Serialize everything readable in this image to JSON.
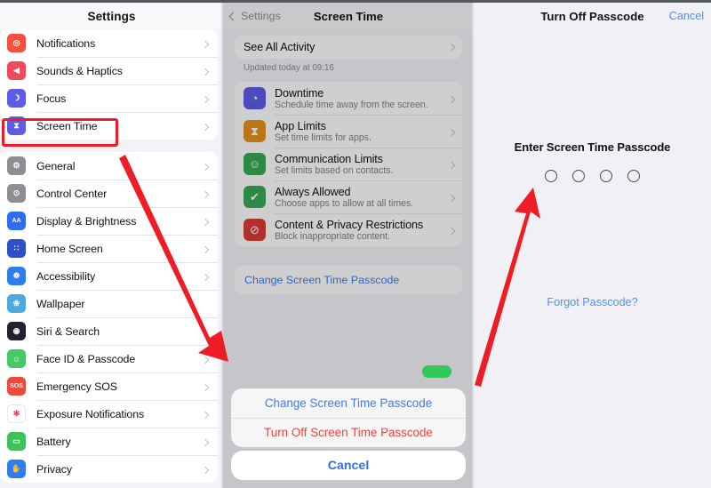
{
  "sidebar": {
    "title": "Settings",
    "groups": [
      {
        "items": [
          {
            "label": "Notifications",
            "icon": "bell-icon",
            "color": "#f4513c",
            "glyph": "◎",
            "chevron": true
          },
          {
            "label": "Sounds & Haptics",
            "icon": "speaker-icon",
            "color": "#ef4a5c",
            "glyph": "◀",
            "chevron": true
          },
          {
            "label": "Focus",
            "icon": "moon-icon",
            "color": "#5c5ce6",
            "glyph": "☽",
            "chevron": true
          },
          {
            "label": "Screen Time",
            "icon": "hourglass-icon",
            "color": "#5c5ce6",
            "glyph": "⧗",
            "chevron": true
          }
        ]
      },
      {
        "items": [
          {
            "label": "General",
            "icon": "gear-icon",
            "color": "#8e8e93",
            "glyph": "⚙",
            "chevron": true
          },
          {
            "label": "Control Center",
            "icon": "sliders-icon",
            "color": "#8e8e93",
            "glyph": "⊙",
            "chevron": true
          },
          {
            "label": "Display & Brightness",
            "icon": "text-size-icon",
            "color": "#2f6cf0",
            "glyph": "AA",
            "chevron": true
          },
          {
            "label": "Home Screen",
            "icon": "home-screen-icon",
            "color": "#2d50c8",
            "glyph": "∷",
            "chevron": true
          },
          {
            "label": "Accessibility",
            "icon": "accessibility-icon",
            "color": "#2f7ef0",
            "glyph": "☸",
            "chevron": true
          },
          {
            "label": "Wallpaper",
            "icon": "wallpaper-icon",
            "color": "#4ea8e0",
            "glyph": "❀",
            "chevron": false
          },
          {
            "label": "Siri & Search",
            "icon": "siri-icon",
            "color": "#241f33",
            "glyph": "◉",
            "chevron": false
          },
          {
            "label": "Face ID & Passcode",
            "icon": "face-id-icon",
            "color": "#48c863",
            "glyph": "☺",
            "chevron": true
          },
          {
            "label": "Emergency SOS",
            "icon": "sos-icon",
            "color": "#ec4a3c",
            "glyph": "SOS",
            "chevron": true
          },
          {
            "label": "Exposure Notifications",
            "icon": "exposure-icon",
            "color": "#ffffff",
            "glyph": "✻",
            "chevron": true
          },
          {
            "label": "Battery",
            "icon": "battery-icon",
            "color": "#3ec25a",
            "glyph": "▭",
            "chevron": true
          },
          {
            "label": "Privacy",
            "icon": "hand-icon",
            "color": "#2f7ef0",
            "glyph": "✋",
            "chevron": true
          }
        ]
      }
    ],
    "highlighted_item": "Screen Time"
  },
  "middle": {
    "back_label": "Settings",
    "title": "Screen Time",
    "see_all_activity": "See All Activity",
    "updated_note": "Updated today at 09:16",
    "features": [
      {
        "title": "Downtime",
        "subtitle": "Schedule time away from the screen.",
        "icon": "downtime-clock-icon",
        "color": "#5c5ce6"
      },
      {
        "title": "App Limits",
        "subtitle": "Set time limits for apps.",
        "icon": "hourglass-icon",
        "color": "#e2921f"
      },
      {
        "title": "Communication Limits",
        "subtitle": "Set limits based on contacts.",
        "icon": "person-circle-icon",
        "color": "#3aa856"
      },
      {
        "title": "Always Allowed",
        "subtitle": "Choose apps to allow at all times.",
        "icon": "check-badge-icon",
        "color": "#3aa856"
      },
      {
        "title": "Content & Privacy Restrictions",
        "subtitle": "Block inappropriate content.",
        "icon": "no-entry-icon",
        "color": "#d93a36"
      }
    ],
    "change_passcode_link": "Change Screen Time Passcode",
    "action_sheet": {
      "items": [
        {
          "label": "Change Screen Time Passcode",
          "style": "blue"
        },
        {
          "label": "Turn Off Screen Time Passcode",
          "style": "red"
        }
      ],
      "clipped_item": "Turn Off Screen Time",
      "cancel_label": "Cancel"
    }
  },
  "right": {
    "title": "Turn Off Passcode",
    "cancel_label": "Cancel",
    "prompt": "Enter Screen Time Passcode",
    "passcode_digits": 4,
    "forgot_label": "Forgot Passcode?"
  },
  "annotations": {
    "highlight_color": "#ee1c24",
    "arrow_color": "#ee1c24",
    "arrow_count": 2
  }
}
